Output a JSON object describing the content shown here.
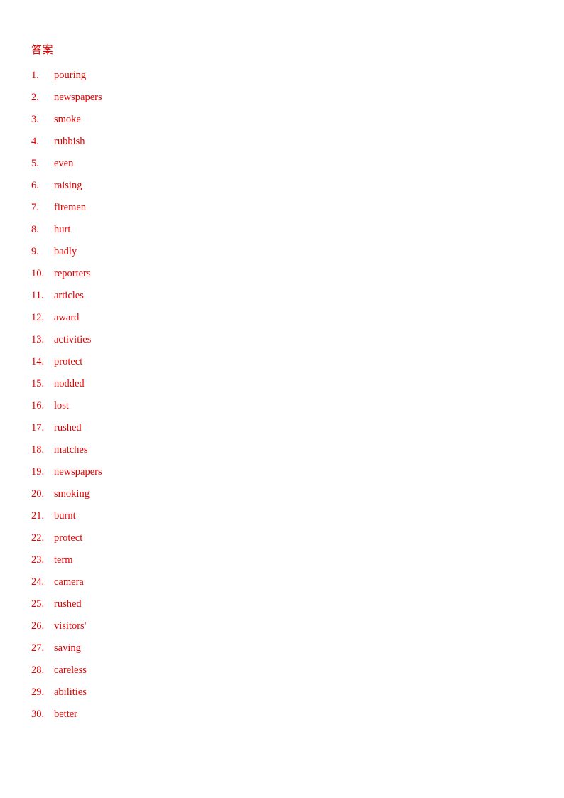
{
  "page": {
    "background_color": "#ffffff",
    "text_color": "#e30000"
  },
  "document": {
    "heading": "答案",
    "answers": [
      {
        "index": "1.",
        "word": "pouring"
      },
      {
        "index": "2.",
        "word": "newspapers"
      },
      {
        "index": "3.",
        "word": "smoke"
      },
      {
        "index": "4.",
        "word": "rubbish"
      },
      {
        "index": "5.",
        "word": "even"
      },
      {
        "index": "6.",
        "word": "raising"
      },
      {
        "index": "7.",
        "word": "firemen"
      },
      {
        "index": "8.",
        "word": "hurt"
      },
      {
        "index": "9.",
        "word": "badly"
      },
      {
        "index": "10.",
        "word": "reporters"
      },
      {
        "index": "11.",
        "word": "articles"
      },
      {
        "index": "12.",
        "word": "award"
      },
      {
        "index": "13.",
        "word": "activities"
      },
      {
        "index": "14.",
        "word": "protect"
      },
      {
        "index": "15.",
        "word": "nodded"
      },
      {
        "index": "16.",
        "word": "lost"
      },
      {
        "index": "17.",
        "word": "rushed"
      },
      {
        "index": "18.",
        "word": "matches"
      },
      {
        "index": "19.",
        "word": "newspapers"
      },
      {
        "index": "20.",
        "word": "smoking"
      },
      {
        "index": "21.",
        "word": "burnt"
      },
      {
        "index": "22.",
        "word": "protect"
      },
      {
        "index": "23.",
        "word": "term"
      },
      {
        "index": "24.",
        "word": "camera"
      },
      {
        "index": "25.",
        "word": "rushed"
      },
      {
        "index": "26.",
        "word": "visitors'"
      },
      {
        "index": "27.",
        "word": "saving"
      },
      {
        "index": "28.",
        "word": "careless"
      },
      {
        "index": "29.",
        "word": "abilities"
      },
      {
        "index": "30.",
        "word": "better"
      }
    ]
  }
}
